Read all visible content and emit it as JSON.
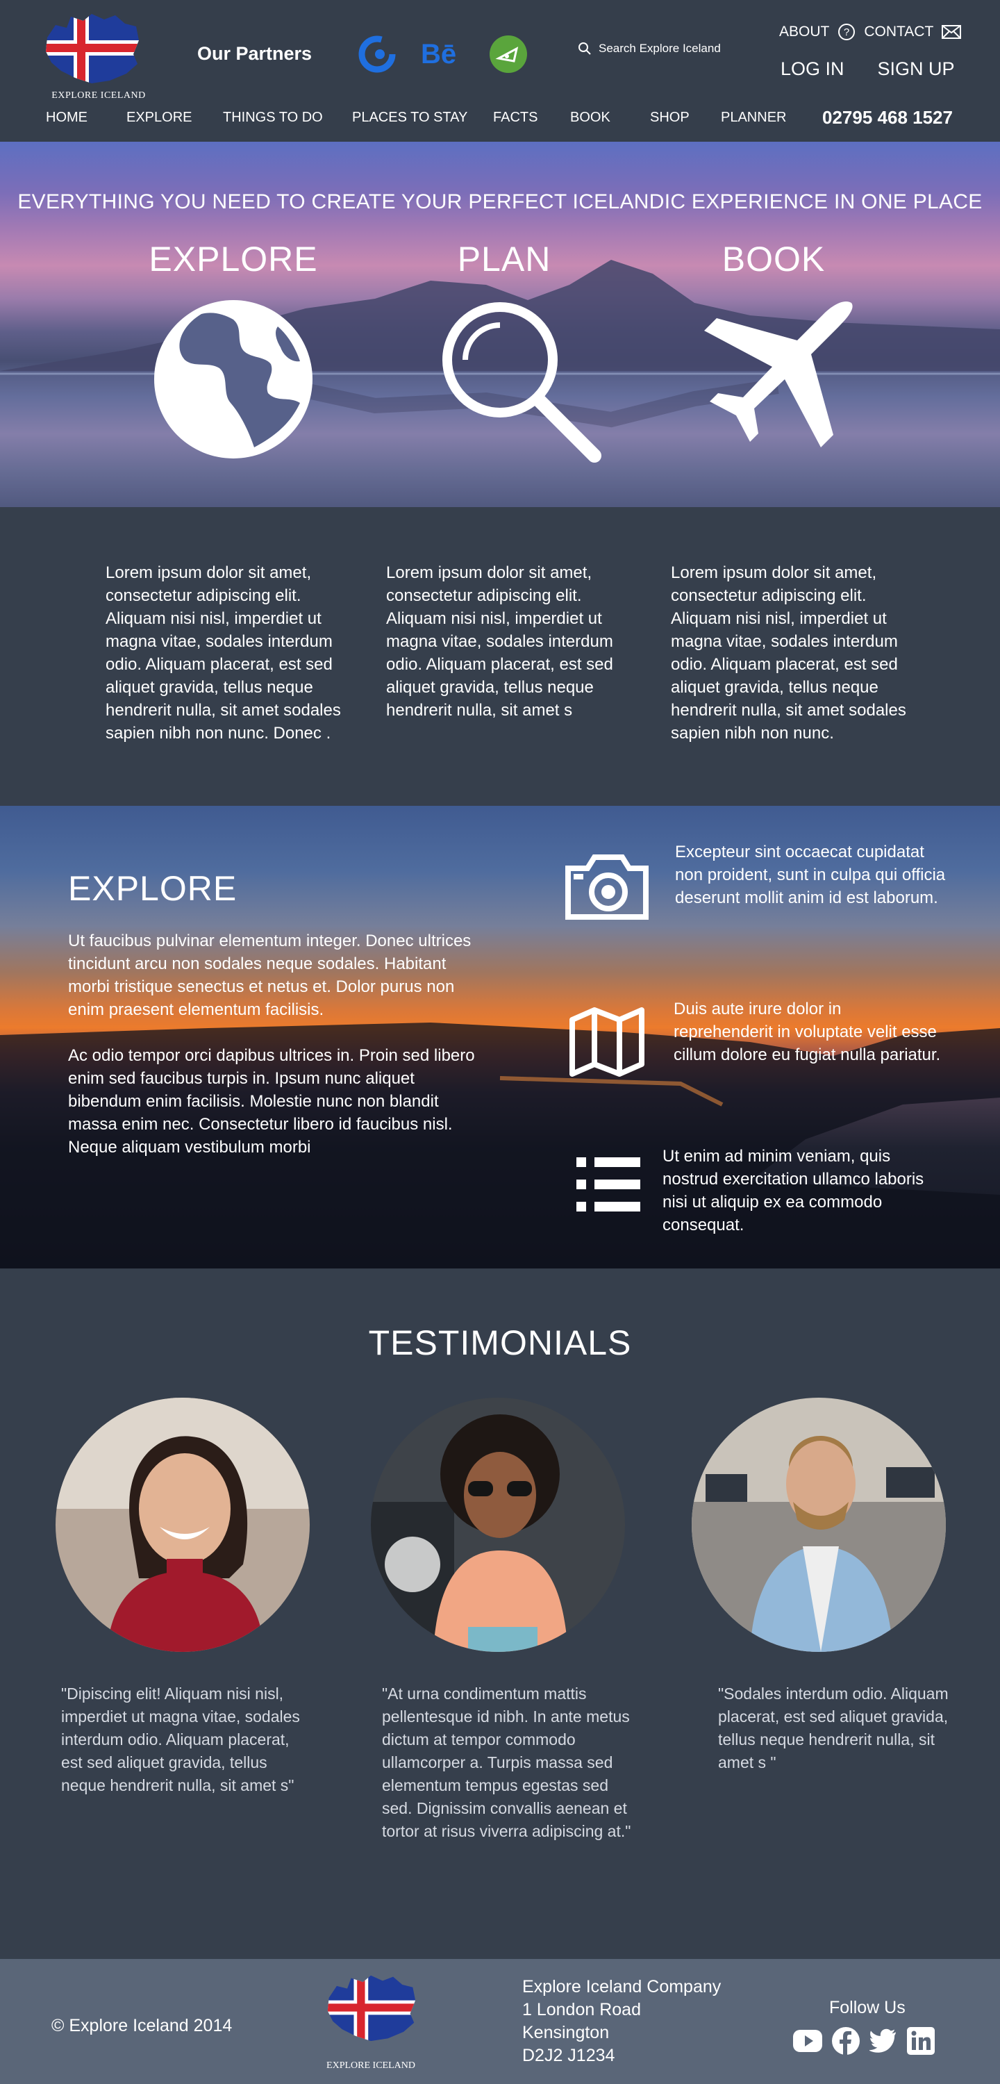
{
  "header": {
    "logo_caption": "EXPLORE ICELAND",
    "partners_label": "Our Partners",
    "partners": [
      {
        "icon": "partner-c-logo-icon",
        "color": "#1f6fe0"
      },
      {
        "icon": "behance-logo-icon",
        "label": "Bē",
        "color": "#1f6fe0"
      },
      {
        "icon": "partner-green-logo-icon",
        "color": "#5aa53c"
      }
    ],
    "search_placeholder": "Search Explore Iceland",
    "about_label": "ABOUT",
    "contact_label": "CONTACT",
    "login_label": "LOG IN",
    "signup_label": "SIGN UP",
    "nav": [
      "HOME",
      "EXPLORE",
      "THINGS TO DO",
      "PLACES TO STAY",
      "FACTS",
      "BOOK",
      "SHOP",
      "PLANNER"
    ],
    "phone": "02795 468 1527"
  },
  "hero": {
    "tagline": "EVERYTHING YOU NEED TO CREATE YOUR PERFECT ICELANDIC EXPERIENCE IN ONE PLACE",
    "columns": [
      {
        "title": "EXPLORE",
        "icon": "globe-icon"
      },
      {
        "title": "PLAN",
        "icon": "magnifier-icon"
      },
      {
        "title": "BOOK",
        "icon": "airplane-icon"
      }
    ]
  },
  "intro": [
    "Lorem ipsum dolor sit amet, consectetur adipiscing elit. Aliquam nisi nisl, imperdiet ut magna vitae, sodales interdum odio. Aliquam placerat, est sed aliquet gravida, tellus neque hendrerit nulla, sit amet sodales sapien nibh non nunc. Donec .",
    "Lorem ipsum dolor sit amet, consectetur adipiscing elit. Aliquam nisi nisl, imperdiet ut magna vitae, sodales interdum odio. Aliquam placerat, est sed aliquet gravida, tellus neque hendrerit nulla, sit amet s",
    "Lorem ipsum dolor sit amet, consectetur adipiscing elit. Aliquam nisi nisl, imperdiet ut magna vitae, sodales interdum odio. Aliquam placerat, est sed aliquet gravida, tellus neque hendrerit nulla, sit amet sodales sapien nibh non nunc."
  ],
  "explore": {
    "title": "EXPLORE",
    "paragraph1": "Ut faucibus pulvinar elementum integer. Donec ultrices tincidunt arcu non sodales neque sodales. Habitant morbi tristique senectus et netus et. Dolor purus non enim praesent elementum facilisis.",
    "paragraph2": "Ac odio tempor orci dapibus ultrices in. Proin sed libero enim sed faucibus turpis in. Ipsum nunc aliquet bibendum enim facilisis. Molestie nunc non blandit massa enim nec. Consectetur libero id faucibus nisl. Neque aliquam vestibulum morbi",
    "features": [
      {
        "icon": "camera-icon",
        "text": "Excepteur sint occaecat cupidatat non proident, sunt in culpa qui officia deserunt mollit anim id est laborum."
      },
      {
        "icon": "map-icon",
        "text": "Duis aute irure dolor in reprehenderit in voluptate velit esse cillum dolore eu fugiat nulla pariatur."
      },
      {
        "icon": "list-icon",
        "text": "Ut enim ad minim veniam, quis nostrud exercitation ullamco laboris nisi ut aliquip ex ea commodo consequat."
      }
    ]
  },
  "testimonials": {
    "title": "TESTIMONIALS",
    "items": [
      {
        "quote": "\"Dipiscing elit! Aliquam nisi nisl, imperdiet ut magna vitae, sodales interdum odio. Aliquam placerat, est sed aliquet gravida, tellus neque hendrerit nulla, sit amet s\""
      },
      {
        "quote": "\"At urna condimentum mattis pellentesque id nibh. In ante metus dictum at tempor commodo ullamcorper a. Turpis massa sed elementum tempus egestas sed sed. Dignissim convallis aenean et tortor at risus viverra adipiscing at.\""
      },
      {
        "quote": "\"Sodales interdum odio. Aliquam placerat, est sed aliquet gravida, tellus neque hendrerit nulla, sit amet s \""
      }
    ]
  },
  "footer": {
    "copyright": "© Explore Iceland 2014",
    "logo_caption": "EXPLORE ICELAND",
    "address": [
      "Explore Iceland Company",
      "1 London Road",
      "Kensington",
      "D2J2 J1234"
    ],
    "follow_label": "Follow Us",
    "social": [
      "youtube-icon",
      "facebook-icon",
      "twitter-icon",
      "linkedin-icon"
    ]
  },
  "colors": {
    "page_bg": "#363f4c",
    "footer_bg": "#5a6678",
    "flag_blue": "#1f3c9b",
    "flag_red": "#d8262e"
  }
}
